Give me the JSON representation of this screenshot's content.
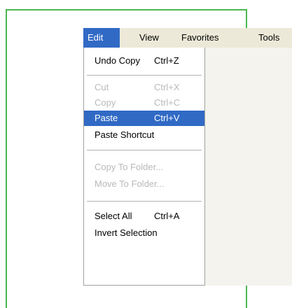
{
  "colors": {
    "frame": "#4bb84f",
    "menubar_bg": "#ece9d8",
    "highlight": "#316ac5",
    "disabled_text": "#b9b9b9"
  },
  "menubar": {
    "items": [
      {
        "label": "Edit",
        "active": true
      },
      {
        "label": "View"
      },
      {
        "label": "Favorites"
      },
      {
        "label": "Tools"
      }
    ]
  },
  "edit_menu": {
    "items": [
      {
        "label": "Undo Copy",
        "shortcut": "Ctrl+Z"
      },
      {
        "label": "Cut",
        "shortcut": "Ctrl+X",
        "disabled": true
      },
      {
        "label": "Copy",
        "shortcut": "Ctrl+C",
        "disabled": true
      },
      {
        "label": "Paste",
        "shortcut": "Ctrl+V",
        "selected": true
      },
      {
        "label": "Paste Shortcut"
      },
      {
        "label": "Copy To Folder...",
        "disabled": true
      },
      {
        "label": "Move To Folder...",
        "disabled": true
      },
      {
        "label": "Select All",
        "shortcut": "Ctrl+A"
      },
      {
        "label": "Invert Selection"
      }
    ]
  }
}
